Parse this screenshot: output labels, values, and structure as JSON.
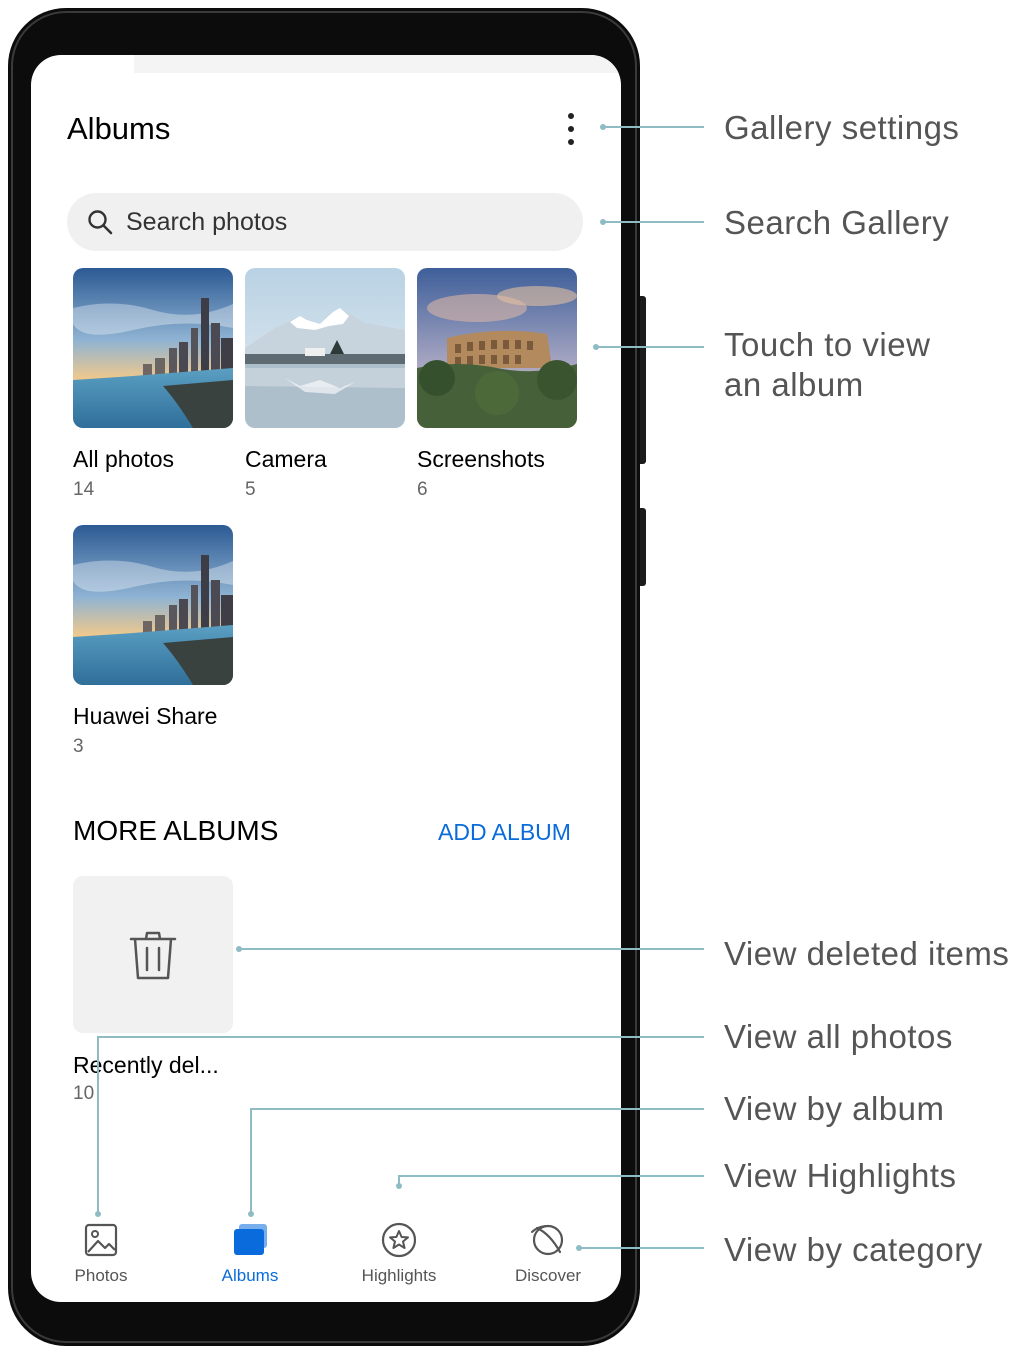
{
  "header": {
    "title": "Albums",
    "menu_icon": "more-vertical-icon"
  },
  "search": {
    "placeholder": "Search photos",
    "icon": "search-icon"
  },
  "albums": [
    {
      "name": "All photos",
      "count": "14",
      "thumbnail": "city-skyline"
    },
    {
      "name": "Camera",
      "count": "5",
      "thumbnail": "snowy-mountain-lake"
    },
    {
      "name": "Screenshots",
      "count": "6",
      "thumbnail": "colosseum"
    },
    {
      "name": "Huawei Share",
      "count": "3",
      "thumbnail": "city-skyline"
    }
  ],
  "more_albums": {
    "title": "MORE ALBUMS",
    "add_label": "ADD ALBUM",
    "items": [
      {
        "name": "Recently del...",
        "count": "10",
        "icon": "trash-icon"
      }
    ]
  },
  "bottom_nav": [
    {
      "label": "Photos",
      "icon": "image-icon",
      "active": false
    },
    {
      "label": "Albums",
      "icon": "albums-icon",
      "active": true
    },
    {
      "label": "Highlights",
      "icon": "star-badge-icon",
      "active": false
    },
    {
      "label": "Discover",
      "icon": "planet-icon",
      "active": false
    }
  ],
  "callouts": {
    "gallery_settings": "Gallery settings",
    "search_gallery": "Search Gallery",
    "touch_album_line1": "Touch to view",
    "touch_album_line2": "an album",
    "view_deleted": "View deleted items",
    "view_all_photos": "View all photos",
    "view_by_album": "View by album",
    "view_highlights": "View Highlights",
    "view_by_category": "View by category"
  },
  "colors": {
    "accent": "#0a6cdc",
    "callout_line": "#8fbcc4",
    "frame": "#0c0c0c"
  }
}
